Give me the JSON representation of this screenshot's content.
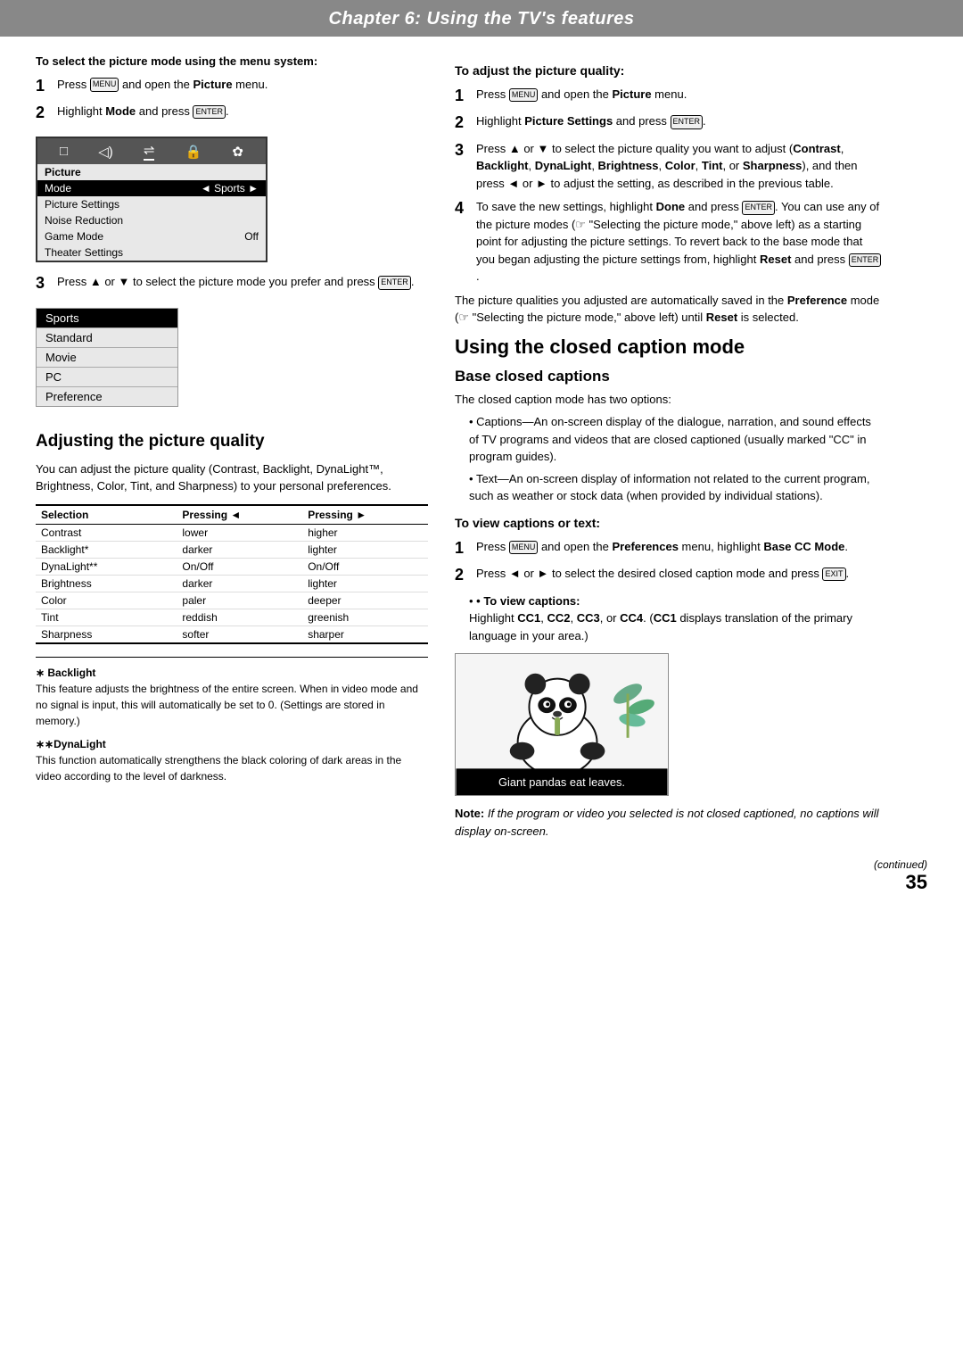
{
  "header": {
    "title": "Chapter 6: Using the TV's features"
  },
  "left_column": {
    "intro_heading": "To select the picture mode using the menu system:",
    "steps_intro": [
      {
        "num": "1",
        "text": "Press ",
        "bold_part": "",
        "rest": "and open the ",
        "bold2": "Picture",
        "rest2": " menu."
      },
      {
        "num": "2",
        "text": "Highlight ",
        "bold_part": "Mode",
        "rest": " and press ",
        "key": "ENTER",
        "rest2": "."
      }
    ],
    "step3_text": "Press ▲ or ▼ to select the picture mode you prefer and press ",
    "menu": {
      "icon_labels": [
        "□",
        "🔊",
        "≡",
        "🔒",
        "☀"
      ],
      "section": "Picture",
      "rows": [
        {
          "label": "Mode",
          "value": "Sports",
          "highlight": true,
          "has_arrows": true
        },
        {
          "label": "Picture Settings",
          "value": "",
          "highlight": false,
          "is_section": false
        },
        {
          "label": "Noise Reduction",
          "value": "",
          "highlight": false
        },
        {
          "label": "Game Mode",
          "value": "Off",
          "highlight": false
        },
        {
          "label": "Theater Settings",
          "value": "",
          "highlight": false
        }
      ]
    },
    "mode_list": [
      "Sports",
      "Standard",
      "Movie",
      "PC",
      "Preference"
    ],
    "mode_active": "Sports",
    "adjusting_heading": "Adjusting the picture quality",
    "adjusting_body": "You can adjust the picture quality (Contrast, Backlight, DynaLight™, Brightness, Color, Tint, and Sharpness) to your personal preferences.",
    "table": {
      "col_headers": [
        "Selection",
        "Pressing ◄",
        "Pressing ►"
      ],
      "rows": [
        [
          "Contrast",
          "lower",
          "higher"
        ],
        [
          "Backlight*",
          "darker",
          "lighter"
        ],
        [
          "DynaLight**",
          "On/Off",
          "On/Off"
        ],
        [
          "Brightness",
          "darker",
          "lighter"
        ],
        [
          "Color",
          "paler",
          "deeper"
        ],
        [
          "Tint",
          "reddish",
          "greenish"
        ],
        [
          "Sharpness",
          "softer",
          "sharper"
        ]
      ]
    },
    "footnotes": [
      {
        "marker": "∗ Backlight",
        "text": "This feature adjusts the brightness of the entire screen. When in video mode and no signal is input, this will automatically be set to 0. (Settings are stored in memory.)"
      },
      {
        "marker": "∗∗DynaLight",
        "text": "This function automatically strengthens the black coloring of dark areas in the video according to the level of darkness."
      }
    ]
  },
  "right_column": {
    "to_adjust_heading": "To adjust the picture quality:",
    "steps": [
      {
        "num": "1",
        "text": "Press ",
        "bold": "MENU",
        "rest": " and open the ",
        "bold2": "Picture",
        "rest2": " menu.",
        "has_key": true
      },
      {
        "num": "2",
        "text": "Highlight ",
        "bold": "Picture Settings",
        "rest": " and press ",
        "key": "ENTER",
        "rest2": "."
      },
      {
        "num": "3",
        "text": "Press ▲ or ▼ to select the picture quality you want to adjust (",
        "bold": "Contrast, Backlight, DynaLight, Brightness, Color, Tint,",
        "rest": " or ",
        "bold2": "Sharpness",
        "rest2": "), and then press ◄ or ► to adjust the setting, as described in the previous table."
      },
      {
        "num": "4",
        "text": "To save the new settings, highlight ",
        "bold": "Done",
        "rest": " and press ",
        "key": "ENTER",
        "rest2": ". You can use any of the picture modes (☞ \"Selecting the picture mode,\" above left) as a starting point for adjusting the picture settings. To revert back to the base mode that you began adjusting the picture settings from, highlight ",
        "bold3": "Reset",
        "rest3": " and press ",
        "key2": "ENTER",
        "rest4": "."
      }
    ],
    "para_preference": "The picture qualities you adjusted are automatically saved in the ",
    "bold_pref": "Preference",
    "para_pref_rest": " mode (☞ \"Selecting the picture mode,\" above left) until ",
    "bold_reset": "Reset",
    "para_pref_end": " is selected.",
    "closed_caption_heading": "Using the closed caption mode",
    "base_captions_heading": "Base closed captions",
    "base_intro": "The closed caption mode has two options:",
    "bullet_items": [
      "Captions—An on-screen display of the dialogue, narration, and sound effects of TV programs and videos that are closed captioned (usually marked \"CC\" in program guides).",
      "Text—An on-screen display of information not related to the current program, such as weather or stock data (when provided by individual stations)."
    ],
    "to_view_heading": "To view captions or text:",
    "view_steps": [
      {
        "num": "1",
        "text": "Press ",
        "bold": "MENU",
        "rest": " and open the ",
        "bold2": "Preferences",
        "rest2": " menu, highlight ",
        "bold3": "Base CC Mode",
        "rest3": "."
      },
      {
        "num": "2",
        "text": "Press ◄ or ► to select the desired closed caption mode and press ",
        "bold": "EXIT",
        "rest": "."
      }
    ],
    "to_view_captions_bullet": "To view captions:",
    "to_view_captions_text": "Highlight ",
    "cc_bold": "CC1, CC2, CC3,",
    "cc_rest": " or ",
    "cc_bold2": "CC4",
    "cc_rest2": ". (",
    "cc_bold3": "CC1",
    "cc_rest3": " displays translation of the primary language in your area.)",
    "panda_caption": "Giant pandas eat leaves.",
    "note_bold": "Note:",
    "note_text": " If the program or video you selected is not closed captioned, no captions will display on-screen.",
    "continued": "(continued)",
    "page_number": "35"
  }
}
